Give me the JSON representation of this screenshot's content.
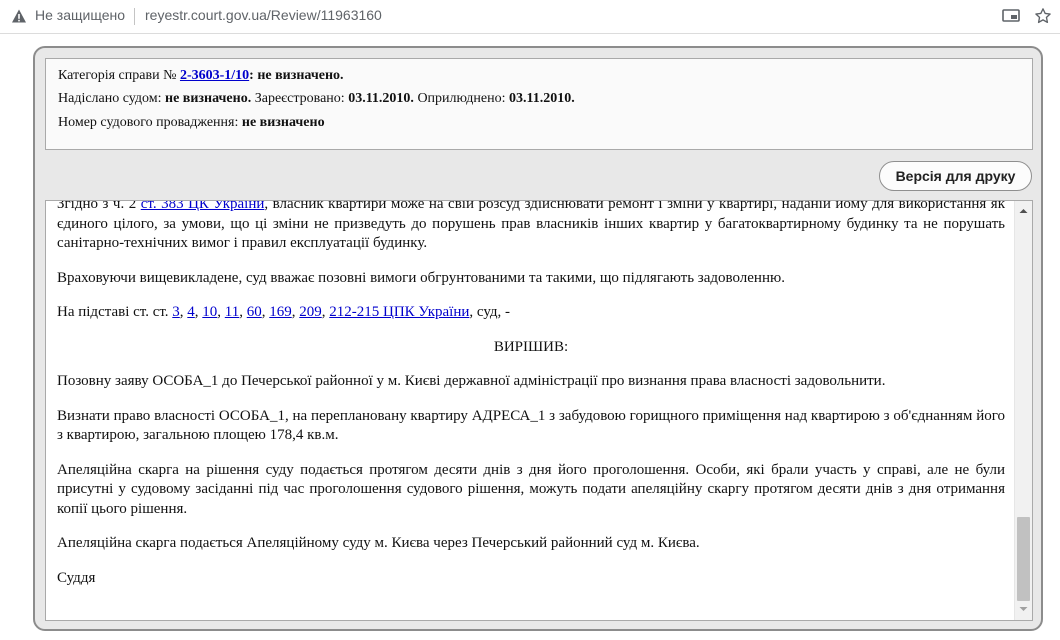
{
  "browser": {
    "security_text": "Не защищено",
    "url": "reyestr.court.gov.ua/Review/11963160"
  },
  "info": {
    "category_label": "Категорія справи № ",
    "case_number": "2-3603-1/10",
    "category_value": ": не визначено.",
    "sent_label": "Надіслано судом: ",
    "sent_value": "не визначено.",
    "registered_label": " Зареєстровано: ",
    "registered_value": "03.11.2010.",
    "published_label": " Оприлюднено: ",
    "published_value": "03.11.2010.",
    "proceeding_label": "Номер судового провадження: ",
    "proceeding_value": "не визначено"
  },
  "print_button": "Версія для друку",
  "document": {
    "p1_start": "Згідно з ч. 2 ",
    "p1_link": "ст. 383 ЦК України",
    "p1_rest": ", власник квартири може на свій розсуд здійснювати ремонт і зміни у квартирі, наданій йому для використання як єдиного цілого, за умови, що ці зміни не призведуть до порушень прав власників інших квартир у багатоквартирному будинку та не порушать санітарно-технічних вимог і правил експлуатації будинку.",
    "p2": "Враховуючи вищевикладене, суд вважає позовні вимоги обгрунтованими та такими, що підлягають задоволенню.",
    "p3_start": "На підставі ст. ст. ",
    "p3_links": [
      "3",
      "4",
      "10",
      "11",
      "60",
      "169",
      "209",
      "212-215 ЦПК України"
    ],
    "p3_end": ", суд, -",
    "heading": "ВИРІШИВ:",
    "p4": "Позовну заяву ОСОБА_1 до Печерської районної у м. Києві державної адміністрації про визнання права власності задовольнити.",
    "p5": "Визнати право власності ОСОБА_1, на переплановану квартиру АДРЕСА_1 з забудовою горищного приміщення над квартирою з об'єднанням його з квартирою, загальною площею 178,4 кв.м.",
    "p6": "Апеляційна скарга на рішення суду подається протягом десяти днів з дня його проголошення. Особи, які брали участь у справі, але не були присутні у судовому засіданні під час проголошення судового рішення, можуть подати апеляційну скаргу протягом десяти днів з дня отримання копії цього рішення.",
    "p7": "Апеляційна скарга подається Апеляційному суду м. Києва через Печерський районний суд м. Києва.",
    "signature": "Суддя"
  }
}
